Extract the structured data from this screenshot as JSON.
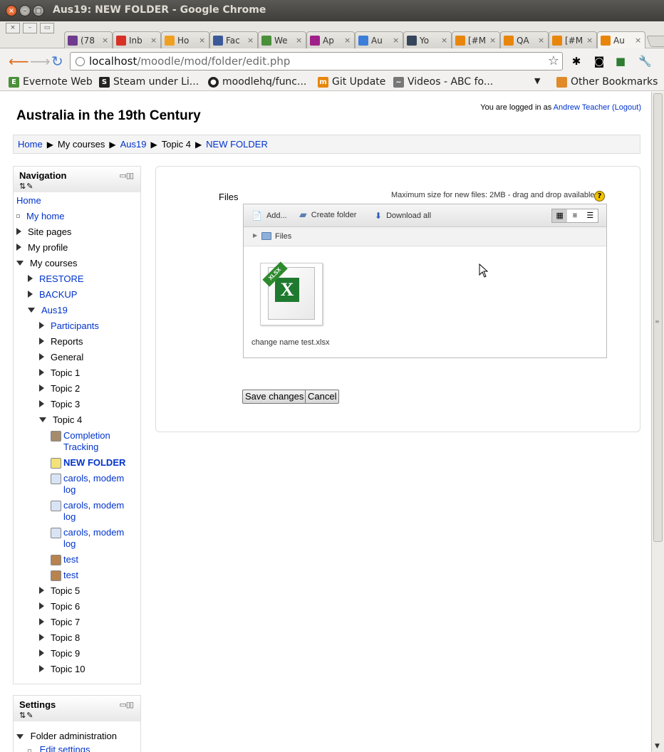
{
  "window": {
    "title": "Aus19: NEW FOLDER - Google Chrome",
    "tabs": [
      {
        "label": "(78",
        "icon": "mail-icon",
        "color": "#6e3b8f"
      },
      {
        "label": "Inb",
        "icon": "gmail-icon",
        "color": "#d93025"
      },
      {
        "label": "Ho",
        "icon": "hotmail-icon",
        "color": "#f0a020"
      },
      {
        "label": "Fac",
        "icon": "facebook-icon",
        "color": "#3b5998"
      },
      {
        "label": "We",
        "icon": "evernote-icon",
        "color": "#4a8f3a"
      },
      {
        "label": "Ap",
        "icon": "feather-icon",
        "color": "#a0208a"
      },
      {
        "label": "Au",
        "icon": "pinwheel-icon",
        "color": "#3b7dd8"
      },
      {
        "label": "Yo",
        "icon": "tumblr-icon",
        "color": "#35465c"
      },
      {
        "label": "[#M",
        "icon": "moodle-icon",
        "color": "#e8860c"
      },
      {
        "label": "QA",
        "icon": "moodle-icon",
        "color": "#e8860c"
      },
      {
        "label": "[#M",
        "icon": "moodle-icon",
        "color": "#e8860c"
      },
      {
        "label": "Au",
        "icon": "moodle-icon",
        "color": "#e8860c"
      }
    ],
    "url_host": "localhost",
    "url_path": "/moodle/mod/folder/edit.php",
    "bookmarks": [
      {
        "label": "Evernote Web",
        "color": "#4a8f3a"
      },
      {
        "label": "Steam under Li...",
        "color": "#222"
      },
      {
        "label": "moodlehq/func...",
        "color": "#222"
      },
      {
        "label": "Git Update",
        "color": "#e8860c"
      },
      {
        "label": "Videos - ABC fo...",
        "color": "#777"
      }
    ],
    "other_bookmarks": "Other Bookmarks"
  },
  "page": {
    "site_title": "Australia in the 19th Century",
    "login_prefix": "You are logged in as",
    "login_user": "Andrew Teacher",
    "logout": "(Logout)",
    "breadcrumb": [
      "Home",
      "My courses",
      "Aus19",
      "Topic 4",
      "NEW FOLDER"
    ]
  },
  "navigation": {
    "title": "Navigation",
    "items": [
      {
        "label": "Home"
      },
      {
        "label": "My home"
      },
      {
        "label": "Site pages"
      },
      {
        "label": "My profile"
      },
      {
        "label": "My courses"
      },
      {
        "label": "RESTORE"
      },
      {
        "label": "BACKUP"
      },
      {
        "label": "Aus19"
      },
      {
        "label": "Participants"
      },
      {
        "label": "Reports"
      },
      {
        "label": "General"
      },
      {
        "label": "Topic 1"
      },
      {
        "label": "Topic 2"
      },
      {
        "label": "Topic 3"
      },
      {
        "label": "Topic 4"
      },
      {
        "label": "Completion Tracking"
      },
      {
        "label": "NEW FOLDER"
      },
      {
        "label": "carols, modem log"
      },
      {
        "label": "carols, modem log"
      },
      {
        "label": "carols, modem log"
      },
      {
        "label": "test"
      },
      {
        "label": "test"
      },
      {
        "label": "Topic 5"
      },
      {
        "label": "Topic 6"
      },
      {
        "label": "Topic 7"
      },
      {
        "label": "Topic 8"
      },
      {
        "label": "Topic 9"
      },
      {
        "label": "Topic 10"
      }
    ]
  },
  "settings": {
    "title": "Settings",
    "items": [
      {
        "label": "Folder administration"
      },
      {
        "label": "Edit settings"
      }
    ]
  },
  "filemanager": {
    "label": "Files",
    "max_size": "Maximum size for new files: 2MB - drag and drop available",
    "add": "Add...",
    "create_folder": "Create folder",
    "download_all": "Download all",
    "path": "Files",
    "file_badge": "XLSX",
    "file_name": "change name test.xlsx"
  },
  "form": {
    "save": "Save changes",
    "cancel": "Cancel"
  }
}
